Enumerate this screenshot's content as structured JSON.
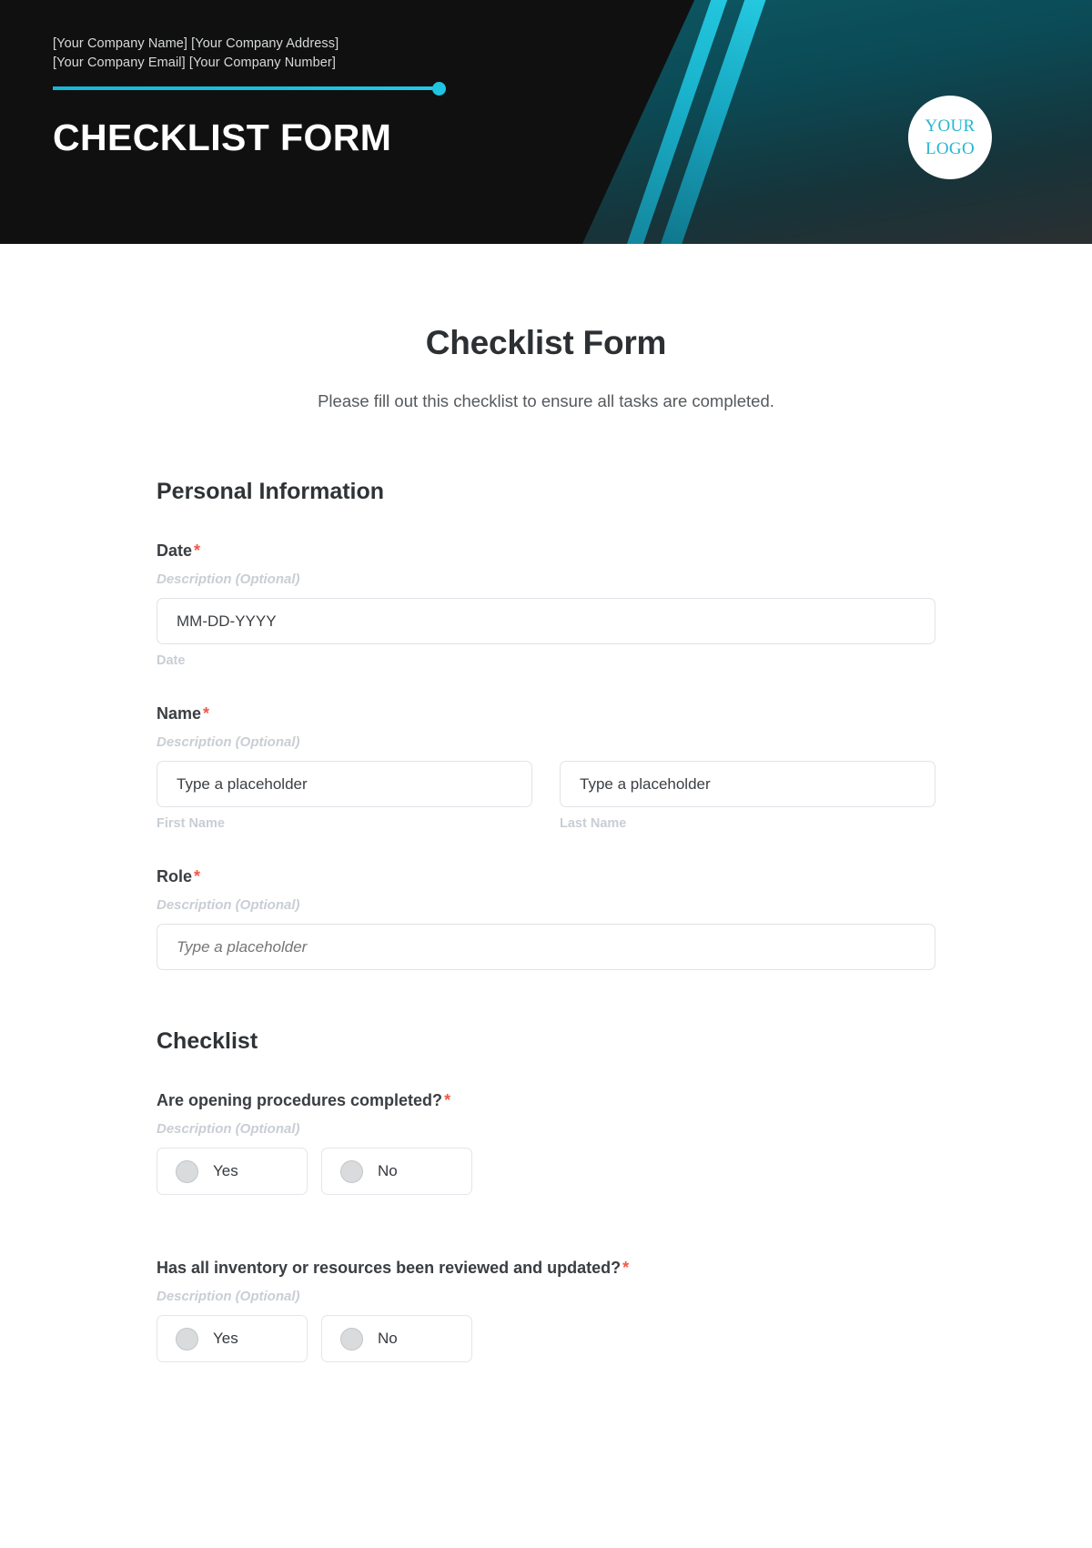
{
  "banner": {
    "company_line_1": "[Your Company Name] [Your Company Address]",
    "company_line_2": "[Your Company Email] [Your Company Number]",
    "title": "CHECKLIST FORM",
    "logo_line_1": "YOUR",
    "logo_line_2": "LOGO",
    "accent_color": "#20c4e3",
    "background_color": "#101010"
  },
  "form": {
    "title": "Checklist Form",
    "subtitle": "Please fill out this checklist to ensure all tasks are completed.",
    "required_marker": "*",
    "description_placeholder": "Description (Optional)",
    "required_color": "#f4564a"
  },
  "sections": {
    "personal": {
      "heading": "Personal Information",
      "date": {
        "label": "Date",
        "description": "Description (Optional)",
        "value": "MM-DD-YYYY",
        "sub_label": "Date"
      },
      "name": {
        "label": "Name",
        "description": "Description (Optional)",
        "first": {
          "value": "Type a placeholder",
          "sub_label": "First Name"
        },
        "last": {
          "value": "Type a placeholder",
          "sub_label": "Last Name"
        }
      },
      "role": {
        "label": "Role",
        "description": "Description (Optional)",
        "placeholder": "Type a placeholder"
      }
    },
    "checklist": {
      "heading": "Checklist",
      "questions": [
        {
          "label": "Are opening procedures completed?",
          "description": "Description (Optional)",
          "options": [
            "Yes",
            "No"
          ]
        },
        {
          "label": "Has all inventory or resources been reviewed and updated?",
          "description": "Description (Optional)",
          "options": [
            "Yes",
            "No"
          ]
        }
      ]
    }
  }
}
